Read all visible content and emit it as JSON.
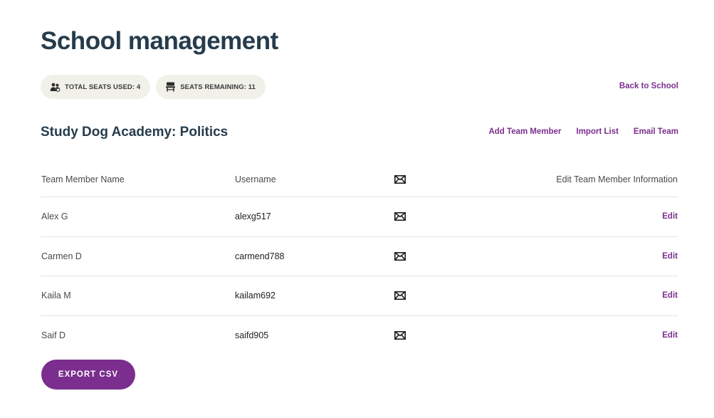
{
  "page": {
    "title": "School management"
  },
  "badges": {
    "total_seats": {
      "label": "TOTAL SEATS USED: 4",
      "icon": "users-icon"
    },
    "seats_remaining": {
      "label": "SEATS REMAINING: 11",
      "icon": "desk-chair-icon"
    }
  },
  "nav": {
    "back_label": "Back to School"
  },
  "section": {
    "title": "Study Dog Academy: Politics",
    "actions": {
      "add": "Add Team Member",
      "import": "Import List",
      "email": "Email Team"
    }
  },
  "table": {
    "headers": {
      "name": "Team Member Name",
      "username": "Username",
      "email_icon": "envelope-icon",
      "edit": "Edit Team Member Information"
    },
    "rows": [
      {
        "name": "Alex G",
        "username": "alexg517",
        "edit": "Edit"
      },
      {
        "name": "Carmen D",
        "username": "carmend788",
        "edit": "Edit"
      },
      {
        "name": "Kaila M",
        "username": "kailam692",
        "edit": "Edit"
      },
      {
        "name": "Saif D",
        "username": "saifd905",
        "edit": "Edit"
      }
    ]
  },
  "footer": {
    "export_label": "EXPORT CSV"
  },
  "colors": {
    "accent": "#7b2e8e",
    "title": "#263c4c",
    "badge_bg": "#f1f1ea"
  }
}
